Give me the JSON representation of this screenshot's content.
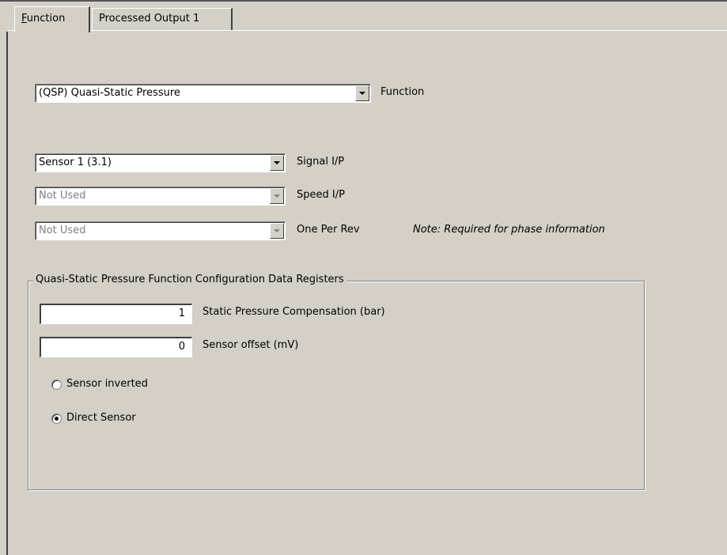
{
  "tabs": [
    {
      "label_first": "F",
      "label_rest": "unction"
    },
    {
      "label": "Processed Output 1"
    }
  ],
  "function_select": {
    "value": "(QSP) Quasi-Static Pressure",
    "label": "Function"
  },
  "signal_select": {
    "value": "Sensor 1 (3.1)",
    "label": "Signal I/P"
  },
  "speed_select": {
    "value": "Not Used",
    "label": "Speed I/P"
  },
  "one_per_rev_select": {
    "value": "Not Used",
    "label": "One Per Rev"
  },
  "note": "Note: Required for phase information",
  "group": {
    "title": "Quasi-Static Pressure Function Configuration Data Registers",
    "static_pressure": {
      "value": "1",
      "label": "Static Pressure Compensation (bar)"
    },
    "sensor_offset": {
      "value": "0",
      "label": "Sensor offset (mV)"
    },
    "radio_inverted": {
      "label": "Sensor inverted",
      "checked": false
    },
    "radio_direct": {
      "label": "Direct Sensor",
      "checked": true
    }
  },
  "colors": {
    "background": "#d4d0c8",
    "disabled_text": "#808080"
  }
}
